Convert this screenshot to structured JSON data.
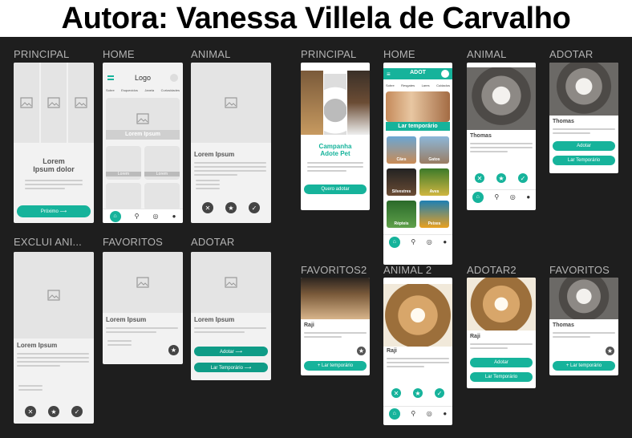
{
  "author_title": "Autora: Vanessa Villela de Carvalho",
  "colors": {
    "teal": "#16b39b",
    "dark_bg": "#1e1e1e",
    "label": "#b3b3b3"
  },
  "wireframes": {
    "labels": [
      "PRINCIPAL",
      "HOME",
      "ANIMAL",
      "EXCLUI ANI...",
      "FAVORITOS",
      "ADOTAR"
    ],
    "principal": {
      "heading": "Lorem\nIpsum dolor",
      "button": "Próximo ⟶"
    },
    "home": {
      "logo": "Logo",
      "tabs": [
        "Sobre",
        "Esquecidos",
        "Janela",
        "Curiosidades"
      ],
      "banner": "Lorem Ipsum",
      "card_a": "Lorem",
      "card_b": "Lorem"
    },
    "animal": {
      "heading": "Lorem Ipsum"
    },
    "exclui": {
      "heading": "Lorem Ipsum"
    },
    "favoritos": {
      "heading": "Lorem Ipsum"
    },
    "adotar": {
      "heading": "Lorem Ipsum",
      "btn1": "Adotar ⟶",
      "btn2": "Lar Temporário ⟶"
    }
  },
  "mockups": {
    "labels": [
      "PRINCIPAL",
      "HOME",
      "ANIMAL",
      "ADOTAR",
      "FAVORITOS2",
      "ANIMAL 2",
      "ADOTAR2",
      "FAVORITOS"
    ],
    "principal": {
      "title": "Campanha\nAdote Pet",
      "button": "Quero adotar"
    },
    "home": {
      "logo": "ADOT",
      "tabs": [
        "Sobre",
        "Resgates",
        "Lares",
        "Cuidados"
      ],
      "banner": "Lar temporário",
      "cats": [
        "Cães",
        "Gatos",
        "Silvestres",
        "Aves",
        "Répteis",
        "Peixes"
      ]
    },
    "animal": {
      "name": "Thomas"
    },
    "adotar": {
      "name": "Thomas",
      "btn1": "Adotar",
      "btn2": "Lar Temporário"
    },
    "favoritos2": {
      "name": "Raji",
      "btn": "+ Lar temporário"
    },
    "animal2": {
      "name": "Raji"
    },
    "adotar2": {
      "name": "Raji",
      "btn1": "Adotar",
      "btn2": "Lar Temporário"
    },
    "favoritos": {
      "name": "Thomas",
      "btn": "+ Lar temporário"
    }
  }
}
